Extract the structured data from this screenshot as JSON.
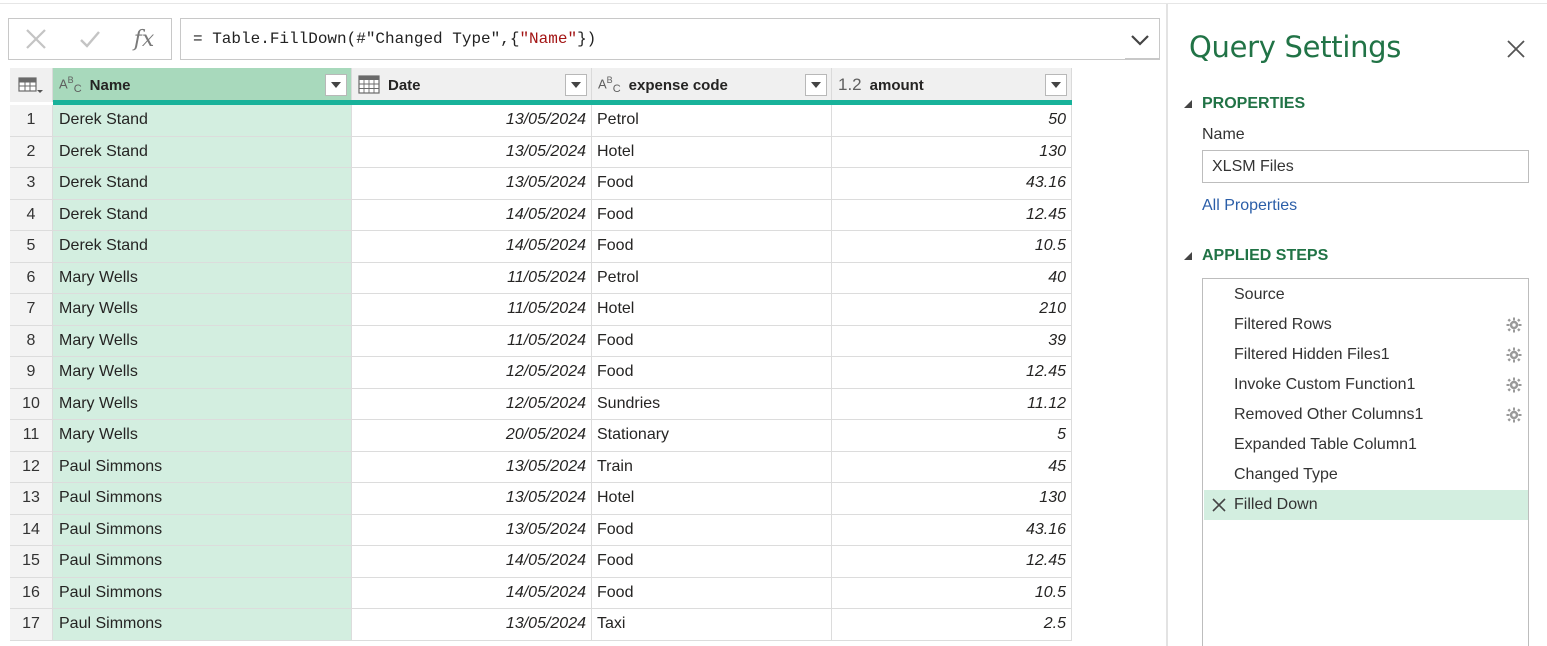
{
  "formula_bar": {
    "cancel_icon": "close-icon",
    "confirm_icon": "check-icon",
    "fx_label": "fx",
    "formula_prefix": "= Table.FillDown(#\"Changed Type\",{",
    "formula_string": "\"Name\"",
    "formula_suffix": "})"
  },
  "grid": {
    "columns": [
      {
        "type_icon": "ABC",
        "label": "Name"
      },
      {
        "type_icon": "calendar-icon",
        "label": "Date"
      },
      {
        "type_icon": "ABC",
        "label": "expense code"
      },
      {
        "type_icon": "1.2",
        "label": "amount"
      }
    ],
    "rows": [
      {
        "index": "1",
        "name": "Derek Stand",
        "date": "13/05/2024",
        "code": "Petrol",
        "amount": "50"
      },
      {
        "index": "2",
        "name": "Derek Stand",
        "date": "13/05/2024",
        "code": "Hotel",
        "amount": "130"
      },
      {
        "index": "3",
        "name": "Derek Stand",
        "date": "13/05/2024",
        "code": "Food",
        "amount": "43.16"
      },
      {
        "index": "4",
        "name": "Derek Stand",
        "date": "14/05/2024",
        "code": "Food",
        "amount": "12.45"
      },
      {
        "index": "5",
        "name": "Derek Stand",
        "date": "14/05/2024",
        "code": "Food",
        "amount": "10.5"
      },
      {
        "index": "6",
        "name": "Mary Wells",
        "date": "11/05/2024",
        "code": "Petrol",
        "amount": "40"
      },
      {
        "index": "7",
        "name": "Mary Wells",
        "date": "11/05/2024",
        "code": "Hotel",
        "amount": "210"
      },
      {
        "index": "8",
        "name": "Mary Wells",
        "date": "11/05/2024",
        "code": "Food",
        "amount": "39"
      },
      {
        "index": "9",
        "name": "Mary Wells",
        "date": "12/05/2024",
        "code": "Food",
        "amount": "12.45"
      },
      {
        "index": "10",
        "name": "Mary Wells",
        "date": "12/05/2024",
        "code": "Sundries",
        "amount": "11.12"
      },
      {
        "index": "11",
        "name": "Mary Wells",
        "date": "20/05/2024",
        "code": "Stationary",
        "amount": "5"
      },
      {
        "index": "12",
        "name": "Paul Simmons",
        "date": "13/05/2024",
        "code": "Train",
        "amount": "45"
      },
      {
        "index": "13",
        "name": "Paul Simmons",
        "date": "13/05/2024",
        "code": "Hotel",
        "amount": "130"
      },
      {
        "index": "14",
        "name": "Paul Simmons",
        "date": "13/05/2024",
        "code": "Food",
        "amount": "43.16"
      },
      {
        "index": "15",
        "name": "Paul Simmons",
        "date": "14/05/2024",
        "code": "Food",
        "amount": "12.45"
      },
      {
        "index": "16",
        "name": "Paul Simmons",
        "date": "14/05/2024",
        "code": "Food",
        "amount": "10.5"
      },
      {
        "index": "17",
        "name": "Paul Simmons",
        "date": "13/05/2024",
        "code": "Taxi",
        "amount": "2.5"
      }
    ]
  },
  "query_settings": {
    "title": "Query Settings",
    "properties_heading": "PROPERTIES",
    "name_label": "Name",
    "name_value": "XLSM Files",
    "all_properties_link": "All Properties",
    "applied_steps_heading": "APPLIED STEPS",
    "steps": [
      {
        "label": "Source",
        "gear": false,
        "active": false
      },
      {
        "label": "Filtered Rows",
        "gear": true,
        "active": false
      },
      {
        "label": "Filtered Hidden Files1",
        "gear": true,
        "active": false
      },
      {
        "label": "Invoke Custom Function1",
        "gear": true,
        "active": false
      },
      {
        "label": "Removed Other Columns1",
        "gear": true,
        "active": false
      },
      {
        "label": "Expanded Table Column1",
        "gear": false,
        "active": false
      },
      {
        "label": "Changed Type",
        "gear": false,
        "active": false
      },
      {
        "label": "Filled Down",
        "gear": false,
        "active": true
      }
    ]
  },
  "colors": {
    "accent_green": "#217346",
    "selected_column": "#d3eee0",
    "header_selected": "#a8d9bc",
    "teal_bar": "#18b29a",
    "link_blue": "#2b5ea8"
  }
}
